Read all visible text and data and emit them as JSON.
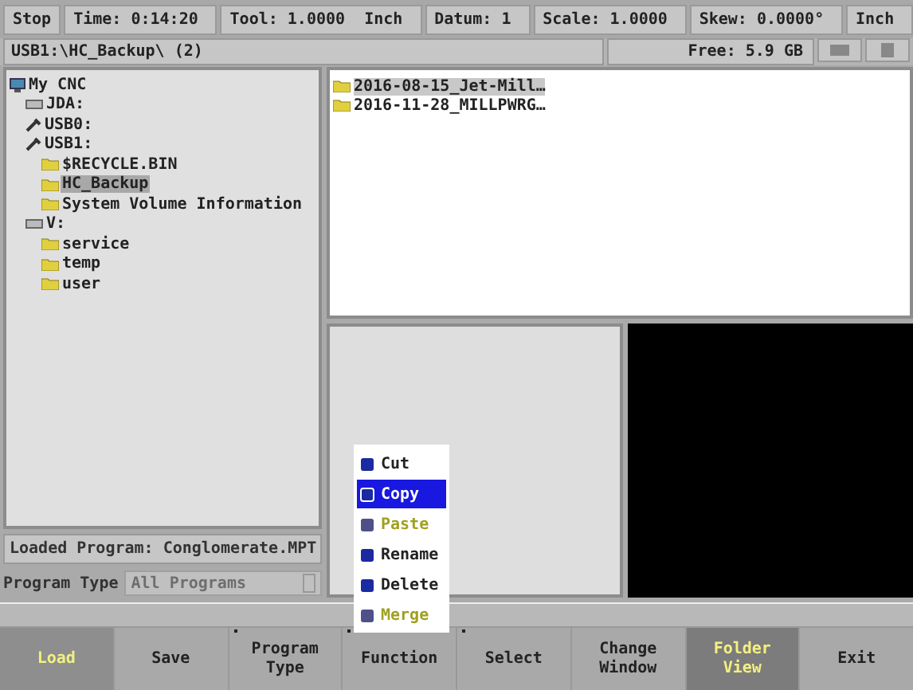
{
  "status_bar": [
    "Stop",
    "Time: 0:14:20",
    "Tool: 1.0000  Inch",
    "Datum: 1",
    "Scale: 1.0000",
    "Skew: 0.0000°",
    "Inch"
  ],
  "path_bar": {
    "path": "USB1:\\HC_Backup\\ (2)",
    "free": "Free: 5.9 GB"
  },
  "tree": [
    {
      "label": "My CNC",
      "kind": "computer",
      "selected": false,
      "children": [
        {
          "label": "JDA:",
          "kind": "drive",
          "selected": false
        },
        {
          "label": "USB0:",
          "kind": "usb",
          "selected": false
        },
        {
          "label": "USB1:",
          "kind": "usb",
          "selected": false,
          "children": [
            {
              "label": "$RECYCLE.BIN",
              "kind": "folder",
              "selected": false
            },
            {
              "label": "HC_Backup",
              "kind": "folder",
              "selected": true
            },
            {
              "label": "System Volume Information",
              "kind": "folder",
              "selected": false
            }
          ]
        },
        {
          "label": "V:",
          "kind": "drive",
          "selected": false,
          "children": [
            {
              "label": "service",
              "kind": "folder",
              "selected": false
            },
            {
              "label": "temp",
              "kind": "folder",
              "selected": false
            },
            {
              "label": "user",
              "kind": "folder",
              "selected": false
            }
          ]
        }
      ]
    }
  ],
  "files": [
    {
      "name": "2016-08-15_Jet-Mill…",
      "selected": true
    },
    {
      "name": "2016-11-28_MILLPWRG…",
      "selected": false
    }
  ],
  "loaded_program": "Loaded Program: Conglomerate.MPT",
  "program_type": {
    "label": "Program Type",
    "value": "All Programs",
    "disabled": true
  },
  "context_menu": [
    {
      "label": "Cut",
      "selected": false,
      "disabled": false
    },
    {
      "label": "Copy",
      "selected": true,
      "disabled": false
    },
    {
      "label": "Paste",
      "selected": false,
      "disabled": true
    },
    {
      "label": "Rename",
      "selected": false,
      "disabled": false
    },
    {
      "label": "Delete",
      "selected": false,
      "disabled": false
    },
    {
      "label": "Merge",
      "selected": false,
      "disabled": true
    }
  ],
  "softkeys": [
    {
      "label": "Load",
      "disabled": true,
      "selected": false,
      "submenu": false
    },
    {
      "label": "Save",
      "disabled": false,
      "selected": false,
      "submenu": false
    },
    {
      "label": "Program\nType",
      "disabled": false,
      "selected": false,
      "submenu": true
    },
    {
      "label": "Function",
      "disabled": false,
      "selected": false,
      "submenu": true
    },
    {
      "label": "Select",
      "disabled": false,
      "selected": false,
      "submenu": true
    },
    {
      "label": "Change\nWindow",
      "disabled": false,
      "selected": false,
      "submenu": false
    },
    {
      "label": "Folder\nView",
      "disabled": false,
      "selected": true,
      "submenu": false
    },
    {
      "label": "Exit",
      "disabled": false,
      "selected": false,
      "submenu": false
    }
  ]
}
